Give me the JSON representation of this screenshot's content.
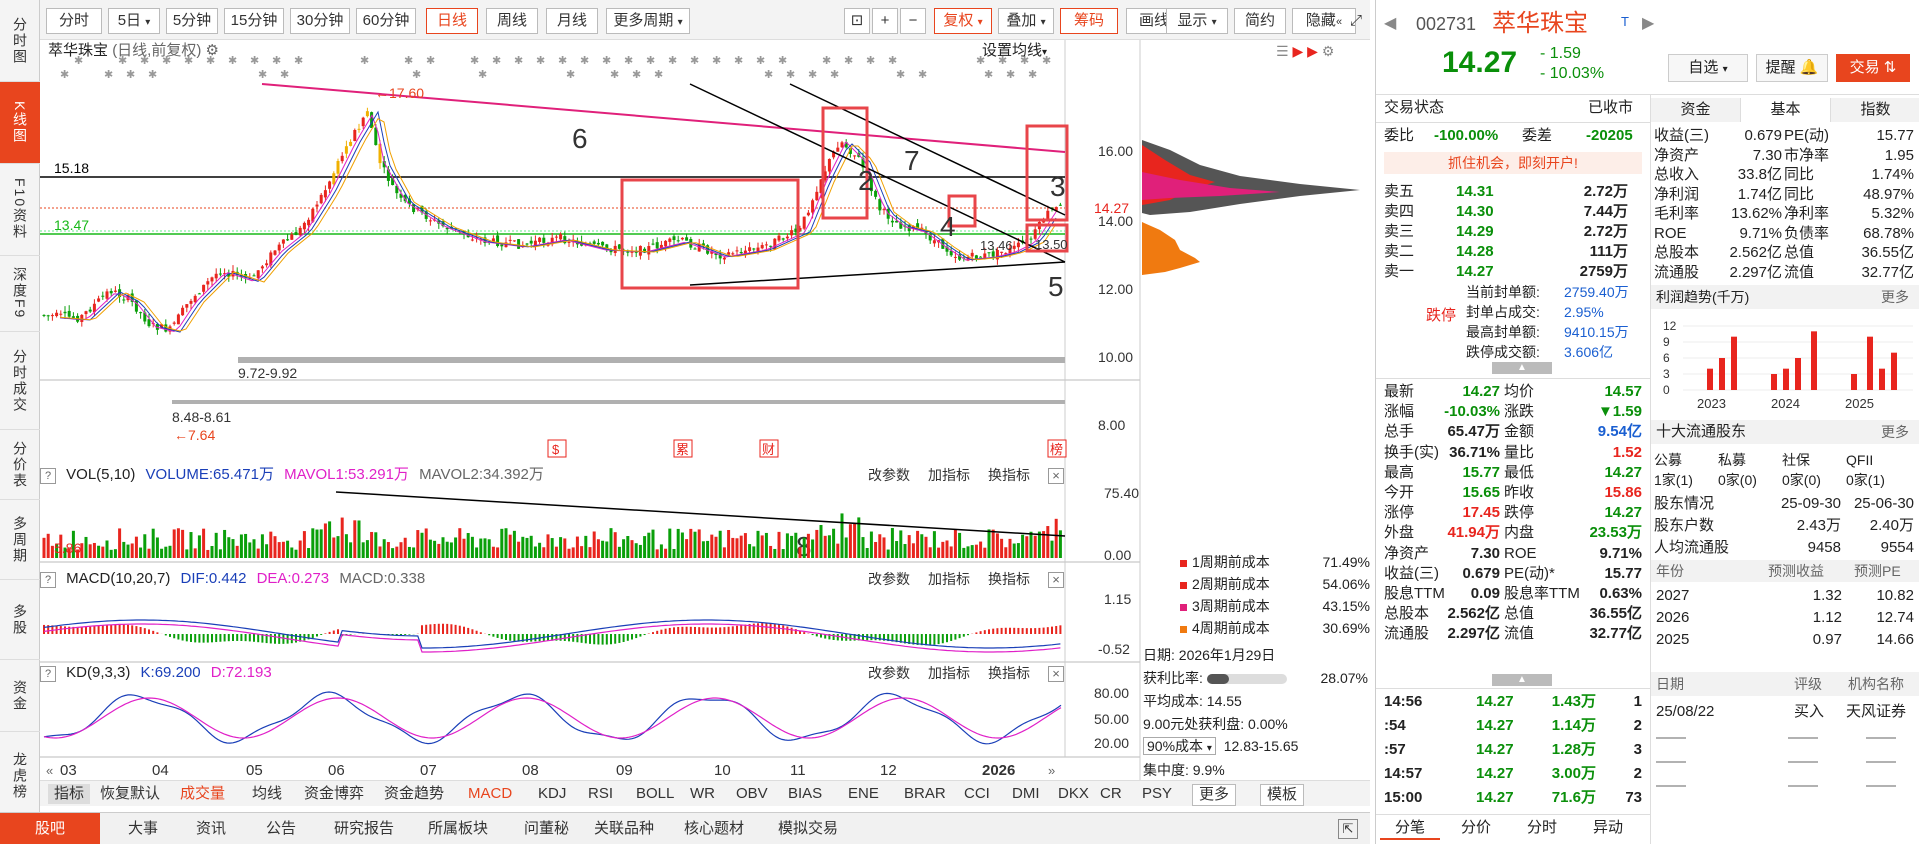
{
  "leftnav": [
    {
      "label": "分时图"
    },
    {
      "label": "K线图"
    },
    {
      "label": "F10资料"
    },
    {
      "label": "深度F9"
    },
    {
      "label": "分时成交"
    },
    {
      "label": "分价表"
    },
    {
      "label": "多周期"
    },
    {
      "label": "多股"
    },
    {
      "label": "资金"
    },
    {
      "label": "龙虎榜"
    }
  ],
  "toolbar": {
    "fenshi": "分时",
    "five_day": "5日",
    "m5": "5分钟",
    "m15": "15分钟",
    "m30": "30分钟",
    "m60": "60分钟",
    "day": "日线",
    "week": "周线",
    "month": "月线",
    "more": "更多周期",
    "fuquan": "复权",
    "diejia": "叠加",
    "chouma": "筹码",
    "huaxian": "画线",
    "xianshi": "显示",
    "jianyue": "简约",
    "yincang": "隐藏"
  },
  "chart": {
    "title": "萃华珠宝",
    "subtitle": "(日线,前复权)",
    "set_ma": "设置均线",
    "price_labels": [
      "16.00",
      "14.00",
      "12.00",
      "10.00",
      "8.00"
    ],
    "current_price_tag": "14.27",
    "level_1518": "15.18",
    "level_1347": "13.47",
    "high_label": "17.60",
    "low_label": "7.64",
    "range_a": "9.72-9.92",
    "range_b": "8.48-8.61",
    "mark_1346": "13.46",
    "mark_1350": "13.50",
    "annotations": [
      "6",
      "7",
      "2",
      "3",
      "4",
      "5",
      "8"
    ],
    "event_tags": [
      "$",
      "累",
      "财",
      "榜"
    ],
    "x_labels": [
      "03",
      "04",
      "05",
      "06",
      "07",
      "08",
      "09",
      "10",
      "11",
      "12",
      "2026"
    ],
    "vol_axis": [
      "75.40",
      "0.00"
    ],
    "macd_axis": [
      "1.15",
      "-0.52"
    ],
    "kd_axis": [
      "80.00",
      "50.00",
      "20.00"
    ],
    "vol_low_label": "5.86"
  },
  "vol_head": {
    "name": "VOL(5,10)",
    "volume": "VOLUME:65.471万",
    "mavol1": "MAVOL1:53.291万",
    "mavol2": "MAVOL2:34.392万"
  },
  "macd_head": {
    "name": "MACD(10,20,7)",
    "dif": "DIF:0.442",
    "dea": "DEA:0.273",
    "macd": "MACD:0.338"
  },
  "kd_head": {
    "name": "KD(9,3,3)",
    "k": "K:69.200",
    "d": "D:72.193"
  },
  "ind_btns": {
    "change": "改参数",
    "add": "加指标",
    "swap": "换指标"
  },
  "cost": {
    "rows": [
      {
        "label": "1周期前成本",
        "pct": "71.49%",
        "color": "#e8251e"
      },
      {
        "label": "2周期前成本",
        "pct": "54.06%",
        "color": "#e8251e"
      },
      {
        "label": "3周期前成本",
        "pct": "43.15%",
        "color": "#e0207a"
      },
      {
        "label": "4周期前成本",
        "pct": "30.69%",
        "color": "#f07a10"
      }
    ],
    "date_label": "日期:",
    "date": "2026年1月29日",
    "profit_label": "获利比率:",
    "profit": "28.07%",
    "avg_cost_label": "平均成本:",
    "avg_cost": "14.55",
    "profit_at_label": "9.00元处获利盘:",
    "profit_at": "0.00%",
    "cost90_select": "90%成本",
    "cost90_range": "12.83-15.65",
    "concentration_label": "集中度:",
    "concentration": "9.9%"
  },
  "indbar": [
    "指标",
    "恢复默认",
    "成交量",
    "均线",
    "资金博弈",
    "资金趋势",
    "MACD",
    "KDJ",
    "RSI",
    "BOLL",
    "WR",
    "OBV",
    "BIAS",
    "ENE",
    "BRAR",
    "CCI",
    "DMI",
    "DKX",
    "CR",
    "PSY",
    "更多",
    "模板"
  ],
  "bottombar": [
    "股吧",
    "大事",
    "资讯",
    "公告",
    "研究报告",
    "所属板块",
    "问董秘",
    "关联品种",
    "核心题材",
    "模拟交易"
  ],
  "stock": {
    "code": "002731",
    "name": "萃华珠宝",
    "tag": "T",
    "price": "14.27",
    "change": "- 1.59",
    "change_pct": "- 10.03%",
    "btn_zixuan": "自选",
    "btn_tixing": "提醒",
    "btn_jiaoyi": "交易",
    "trade_status_label": "交易状态",
    "trade_status": "已收市",
    "weibi_label": "委比",
    "weibi": "-100.00%",
    "weicha_label": "委差",
    "weicha": "-20205",
    "promo": "抓住机会，即刻开户!",
    "asks": [
      {
        "label": "卖五",
        "price": "14.31",
        "vol": "2.72万"
      },
      {
        "label": "卖四",
        "price": "14.30",
        "vol": "7.44万"
      },
      {
        "label": "卖三",
        "price": "14.29",
        "vol": "2.72万"
      },
      {
        "label": "卖二",
        "price": "14.28",
        "vol": "111万"
      },
      {
        "label": "卖一",
        "price": "14.27",
        "vol": "2759万"
      }
    ],
    "limit_label": "跌停",
    "limit_info": [
      {
        "label": "当前封单额:",
        "value": "2759.40万"
      },
      {
        "label": "封单占成交:",
        "value": "2.95%"
      },
      {
        "label": "最高封单额:",
        "value": "9410.15万"
      },
      {
        "label": "跌停成交额:",
        "value": "3.606亿"
      }
    ],
    "quote": [
      [
        "最新",
        "14.27",
        "均价",
        "14.57"
      ],
      [
        "涨幅",
        "-10.03%",
        "涨跌",
        "▼1.59"
      ],
      [
        "总手",
        "65.47万",
        "金额",
        "9.54亿"
      ],
      [
        "换手(实)",
        "36.71%",
        "量比",
        "1.52"
      ],
      [
        "最高",
        "15.77",
        "最低",
        "14.27"
      ],
      [
        "今开",
        "15.65",
        "昨收",
        "15.86"
      ],
      [
        "涨停",
        "17.45",
        "跌停",
        "14.27"
      ],
      [
        "外盘",
        "41.94万",
        "内盘",
        "23.53万"
      ],
      [
        "净资产",
        "7.30",
        "ROE",
        "9.71%"
      ],
      [
        "收益(三)",
        "0.679",
        "PE(动)*",
        "15.77"
      ],
      [
        "股息TTM",
        "0.09",
        "股息率TTM",
        "0.63%"
      ],
      [
        "总股本",
        "2.562亿",
        "总值",
        "36.55亿"
      ],
      [
        "流通股",
        "2.297亿",
        "流值",
        "32.77亿"
      ]
    ],
    "ticks": [
      {
        "time": "14:56",
        "price": "14.27",
        "vol": "1.43万",
        "n": "1"
      },
      {
        "time": ":54",
        "price": "14.27",
        "vol": "1.14万",
        "n": "2"
      },
      {
        "time": ":57",
        "price": "14.27",
        "vol": "1.28万",
        "n": "3"
      },
      {
        "time": "14:57",
        "price": "14.27",
        "vol": "3.00万",
        "n": "2"
      },
      {
        "time": "15:00",
        "price": "14.27",
        "vol": "71.6万",
        "n": "73"
      }
    ],
    "tick_tabs": [
      "分笔",
      "分价",
      "分时",
      "异动"
    ]
  },
  "fund": {
    "tabs": [
      "资金",
      "基本",
      "指数"
    ],
    "rows": [
      [
        "收益(三)",
        "0.679",
        "PE(动)",
        "15.77"
      ],
      [
        "净资产",
        "7.30",
        "市净率",
        "1.95"
      ],
      [
        "总收入",
        "33.8亿",
        "同比",
        "1.74%"
      ],
      [
        "净利润",
        "1.74亿",
        "同比",
        "48.97%"
      ],
      [
        "毛利率",
        "13.62%",
        "净利率",
        "5.32%"
      ],
      [
        "ROE",
        "9.71%",
        "负债率",
        "68.78%"
      ],
      [
        "总股本",
        "2.562亿",
        "总值",
        "36.55亿"
      ],
      [
        "流通股",
        "2.297亿",
        "流值",
        "32.77亿"
      ]
    ],
    "profit_trend_title": "利润趋势(千万)",
    "more": "更多",
    "profit_axis": [
      "12",
      "9",
      "6",
      "3",
      "0"
    ],
    "profit_years": [
      "2023",
      "2024",
      "2025"
    ],
    "profit_bars": [
      4,
      6,
      10,
      3,
      4,
      6,
      11,
      3,
      10,
      4,
      7
    ],
    "top10_title": "十大流通股东",
    "holder_types": [
      "公募",
      "私募",
      "社保",
      "QFII"
    ],
    "holder_counts": [
      "1家(1)",
      "0家(0)",
      "0家(0)",
      "0家(1)"
    ],
    "holder_rows": [
      [
        "股东情况",
        "25-09-30",
        "25-06-30"
      ],
      [
        "股东户数",
        "2.43万",
        "2.40万"
      ],
      [
        "人均流通股",
        "9458",
        "9554"
      ]
    ],
    "forecast_head": [
      "年份",
      "预测收益",
      "预测PE"
    ],
    "forecast_rows": [
      [
        "2027",
        "1.32",
        "10.82"
      ],
      [
        "2026",
        "1.12",
        "12.74"
      ],
      [
        "2025",
        "0.97",
        "14.66"
      ]
    ],
    "rating_head": [
      "日期",
      "评级",
      "机构名称"
    ],
    "rating_rows": [
      [
        "25/08/22",
        "买入",
        "天风证券"
      ]
    ],
    "empty_dash": "——"
  },
  "colors": {
    "accent": "#e8451e",
    "up": "#e8251e",
    "down": "#0a8f0a",
    "link": "#1a5fd1"
  }
}
